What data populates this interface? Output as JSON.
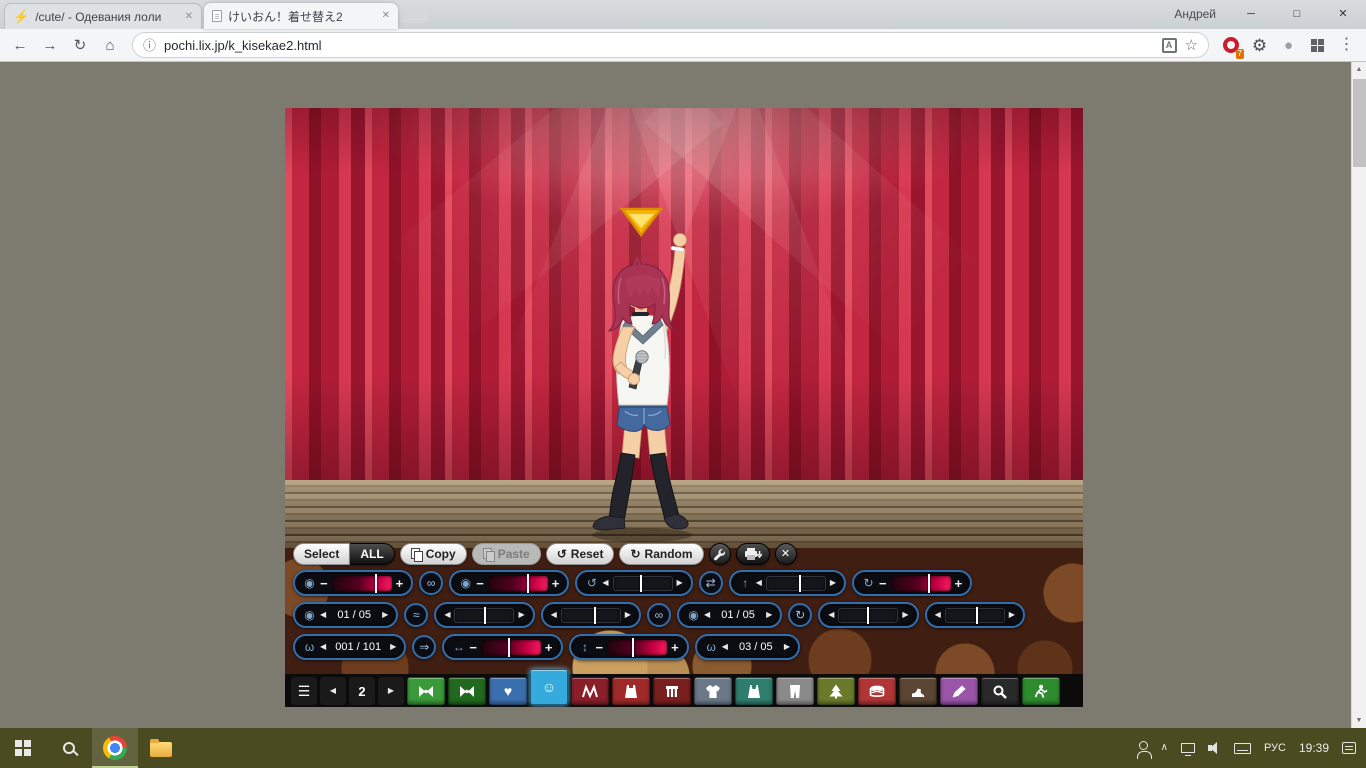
{
  "colors": {
    "taskbar_olive": "#4a4b20",
    "curtain_red": "#c22640",
    "panel_accent_blue": "#2f6fae",
    "slider_magenta": "#e8004d",
    "active_category_blue": "#35aadc"
  },
  "glyphs": {
    "lightning": "⚡",
    "close": "✕",
    "back": "←",
    "forward": "→",
    "reload": "↻",
    "home": "⌂",
    "info": "ⓘ",
    "star": "☆",
    "gear": "⚙",
    "dot": "●",
    "menu_dots": "⋮",
    "minimize": "─",
    "maximize": "□",
    "minus": "−",
    "plus": "+",
    "left": "◀",
    "right": "▶",
    "up": "▲",
    "down": "▼",
    "hamburger": "☰",
    "eye": "◉",
    "brow": "≈",
    "rotate_cw": "↻",
    "rotate_ccw": "↺",
    "link": "∞",
    "swap": "⇄",
    "jump": "⇒",
    "lift": "↑",
    "width": "↔",
    "height": "↕",
    "mouth": "ω",
    "chevron_up": "∧",
    "heart": "♥",
    "smiley": "☺",
    "bow": "⋈",
    "translate": "A"
  },
  "browser": {
    "profile": "Андрей",
    "url": "pochi.lix.jp/k_kisekae2.html",
    "ext_badge": "7",
    "tabs": [
      {
        "title": "/cute/ - Одевания лоли"
      },
      {
        "title": "けいおん！着せ替え2"
      }
    ]
  },
  "game": {
    "toolbar": {
      "select": "Select",
      "all": "ALL",
      "copy": "Copy",
      "paste": "Paste",
      "reset": "Reset",
      "random": "Random"
    },
    "spinners": {
      "eye_style": "01 / 05",
      "brow_style": "01 / 05",
      "mouth_item": "001 / 101",
      "mouth_style": "03 / 05"
    },
    "pager": "2"
  },
  "taskbar": {
    "lang": "РУС",
    "time": "19:39"
  }
}
